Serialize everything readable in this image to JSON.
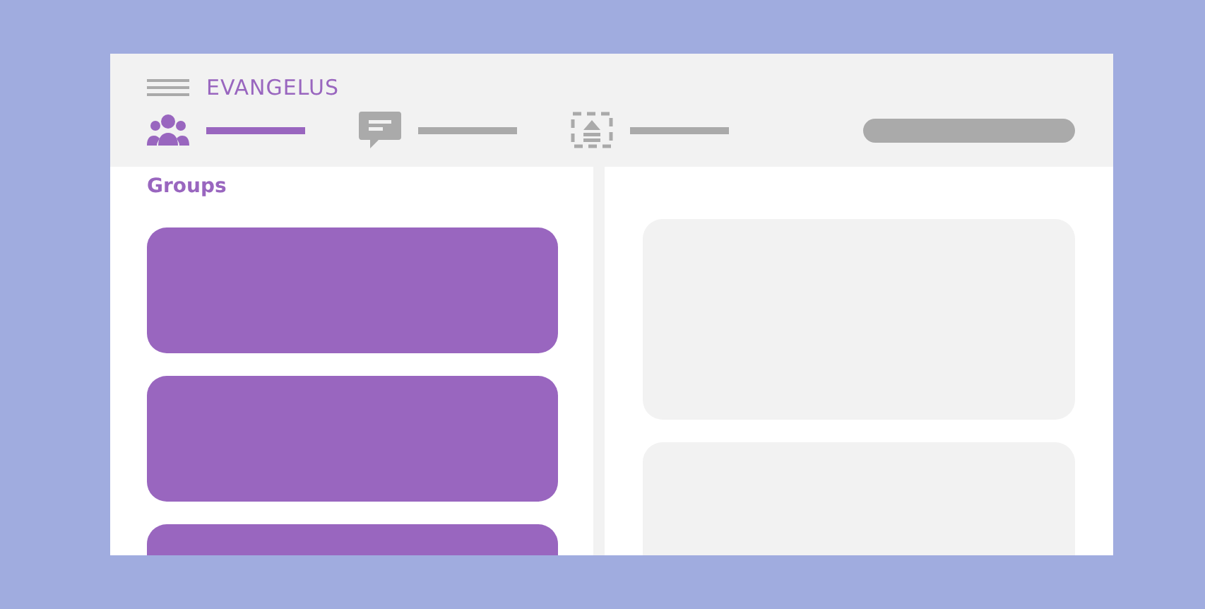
{
  "app": {
    "title": "EVANGELUS"
  },
  "tabs": [
    {
      "kind": "groups",
      "selected": true
    },
    {
      "kind": "messages",
      "selected": false
    },
    {
      "kind": "upload",
      "selected": false
    }
  ],
  "groups": {
    "title": "Groups"
  }
}
